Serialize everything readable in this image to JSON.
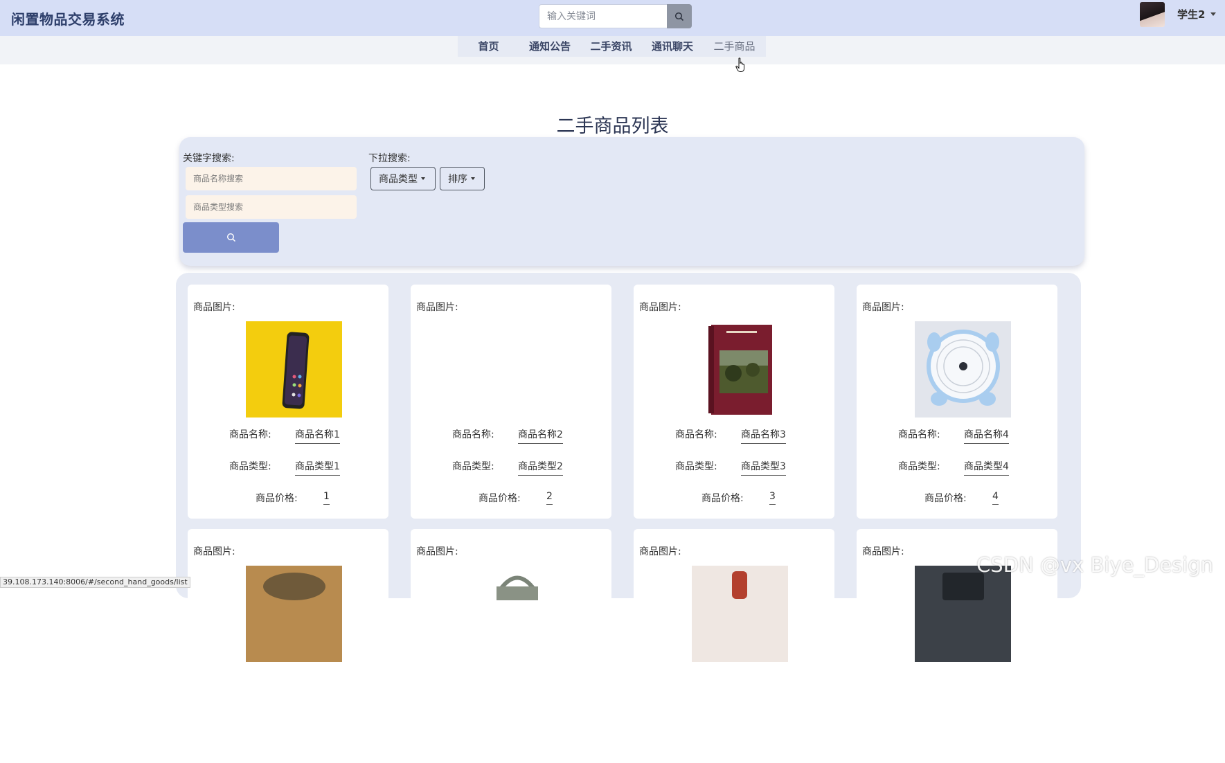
{
  "header": {
    "brand": "闲置物品交易系统",
    "search_placeholder": "输入关键词",
    "user_name": "学生2"
  },
  "nav": {
    "items": [
      {
        "label": "首页"
      },
      {
        "label": "通知公告"
      },
      {
        "label": "二手资讯"
      },
      {
        "label": "通讯聊天"
      },
      {
        "label": "二手商品"
      }
    ],
    "active": "二手商品"
  },
  "page_title": "二手商品列表",
  "search": {
    "keyword_label": "关键字搜索:",
    "name_placeholder": "商品名称搜索",
    "type_placeholder": "商品类型搜索",
    "dropdown_label": "下拉搜索:",
    "type_dropdown": "商品类型",
    "sort_dropdown": "排序"
  },
  "labels": {
    "image": "商品图片:",
    "name": "商品名称:",
    "type": "商品类型:",
    "price": "商品价格:"
  },
  "products": [
    {
      "image": "phone",
      "name": "商品名称1",
      "type": "商品类型1",
      "price": "1"
    },
    {
      "image": "",
      "name": "商品名称2",
      "type": "商品类型2",
      "price": "2"
    },
    {
      "image": "book",
      "name": "商品名称3",
      "type": "商品类型3",
      "price": "3"
    },
    {
      "image": "fan",
      "name": "商品名称4",
      "type": "商品类型4",
      "price": "4"
    }
  ],
  "products_row2": [
    {
      "image": "cap"
    },
    {
      "image": "bag"
    },
    {
      "image": "bottle"
    },
    {
      "image": "device"
    }
  ],
  "status_url": "39.108.173.140:8006/#/second_hand_goods/list",
  "watermark": "CSDN @vx Biye_Design",
  "colors": {
    "header_bg": "#d6def6",
    "panel_bg": "#e3e8f5",
    "accent_button": "#7b8ecb",
    "input_bg": "#fcf3e9"
  }
}
